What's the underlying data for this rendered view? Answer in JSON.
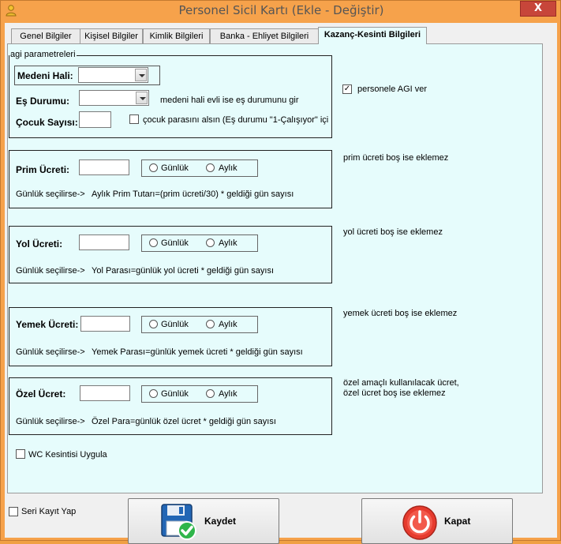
{
  "window": {
    "title": "Personel Sicil Kartı (Ekle - Değiştir)",
    "close_label": "X"
  },
  "tabs": [
    {
      "label": "Genel Bilgiler",
      "active": false
    },
    {
      "label": "Kişisel Bilgiler",
      "active": false
    },
    {
      "label": "Kimlik Bilgileri",
      "active": false
    },
    {
      "label": "Banka - Ehliyet Bilgileri",
      "active": false
    },
    {
      "label": "Kazanç-Kesinti Bilgileri",
      "active": true
    }
  ],
  "agi": {
    "group_title": "agi parametreleri",
    "medeni_hali_label": "Medeni Hali:",
    "medeni_hali_value": "",
    "es_durumu_label": "Eş Durumu:",
    "es_durumu_value": "",
    "es_hint": "medeni hali evli ise eş durumunu gir",
    "cocuk_label": "Çocuk Sayısı:",
    "cocuk_value": "",
    "cocuk_checkbox_label": "çocuk parasını alsın (Eş durumu \"1-Çalışıyor\" içi",
    "cocuk_checkbox_checked": false,
    "agi_ver_label": "personele AGI ver",
    "agi_ver_checked": true
  },
  "radio_labels": {
    "daily": "Günlük",
    "monthly": "Aylık"
  },
  "sections": [
    {
      "id": "prim",
      "label": "Prim Ücreti:",
      "value": "",
      "selection": "none",
      "formula_prefix": "Günlük seçilirse->",
      "formula": "Aylık Prim Tutarı=(prim ücreti/30)  * geldiği gün sayısı",
      "note": "prim ücreti boş ise eklemez"
    },
    {
      "id": "yol",
      "label": "Yol Ücreti:",
      "value": "",
      "selection": "none",
      "formula_prefix": "Günlük seçilirse->",
      "formula": "Yol Parası=günlük yol ücreti * geldiği gün sayısı",
      "note": "yol ücreti boş ise eklemez"
    },
    {
      "id": "yemek",
      "label": "Yemek Ücreti:",
      "value": "",
      "selection": "none",
      "formula_prefix": "Günlük seçilirse->",
      "formula": "Yemek Parası=günlük yemek ücreti * geldiği gün sayısı",
      "note": "yemek ücreti boş ise eklemez"
    },
    {
      "id": "ozel",
      "label": "Özel Ücret:",
      "value": "",
      "selection": "none",
      "formula_prefix": "Günlük seçilirse->",
      "formula": "Özel Para=günlük özel ücret * geldiği gün sayısı",
      "note": "özel amaçlı kullanılacak ücret,",
      "note2": "özel ücret boş ise eklemez"
    }
  ],
  "wc": {
    "label": "WC Kesintisi Uygula",
    "checked": false
  },
  "seri": {
    "label": "Seri Kayıt Yap",
    "checked": false
  },
  "buttons": {
    "save": "Kaydet",
    "close": "Kapat"
  },
  "icons": {
    "app": "person-icon",
    "save": "floppy-disk-check-icon",
    "close": "power-icon"
  },
  "colors": {
    "titlebar": "#f6a24b",
    "panel": "#e6fcfc",
    "close_red": "#c7463a",
    "check_green": "#2fb54a",
    "power_red": "#e63b2e"
  }
}
